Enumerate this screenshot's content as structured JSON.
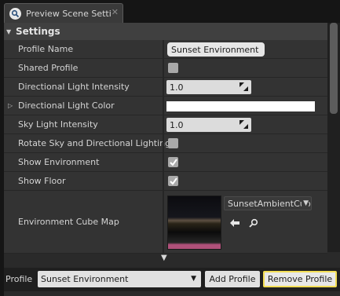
{
  "tab": {
    "title": "Preview Scene Setti",
    "icon": "magnifier-icon",
    "close": "✕"
  },
  "category": {
    "label": "Settings"
  },
  "properties": [
    {
      "name": "Profile Name",
      "value": "Sunset Environment"
    },
    {
      "name": "Shared Profile",
      "checked": false
    },
    {
      "name": "Directional Light Intensity",
      "value": "1.0"
    },
    {
      "name": "Directional Light Color",
      "color": "#ffffff"
    },
    {
      "name": "Sky Light Intensity",
      "value": "1.0"
    },
    {
      "name": "Rotate Sky and Directional Lighting",
      "checked": false
    },
    {
      "name": "Show Environment",
      "checked": true
    },
    {
      "name": "Show Floor",
      "checked": true
    },
    {
      "name": "Environment Cube Map",
      "asset": "SunsetAmbientCubemap"
    }
  ],
  "footer": {
    "profile_label": "Profile",
    "selected_profile": "Sunset Environment",
    "add_label": "Add Profile",
    "remove_label": "Remove Profile"
  },
  "colors": {
    "highlight": "#f2dd55",
    "panel": "#333333",
    "header": "#404040"
  }
}
